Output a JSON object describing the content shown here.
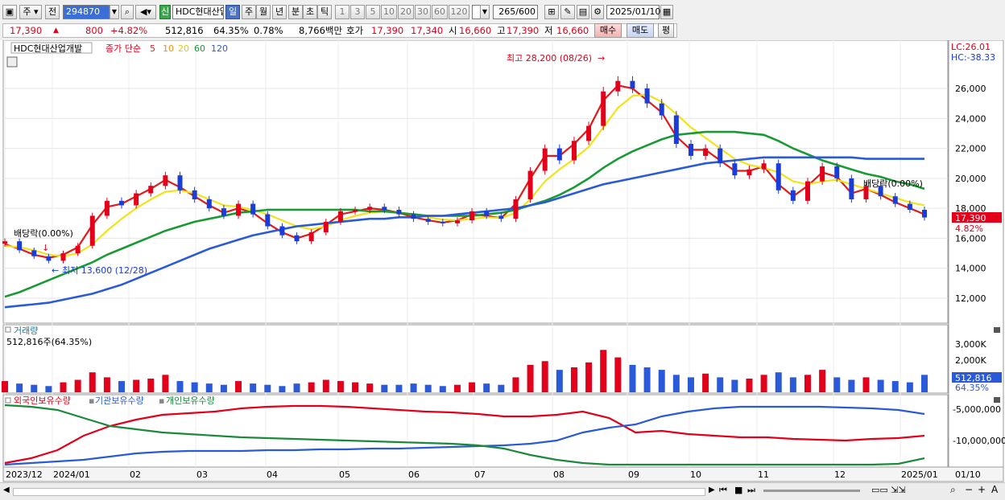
{
  "toolbar": {
    "period_label": "주",
    "prev_label": "전",
    "code_value": "294870",
    "new_badge": "신",
    "stock_name": "HDC현대산업",
    "period_buttons": [
      "일",
      "주",
      "월",
      "년",
      "분",
      "초",
      "틱"
    ],
    "interval_buttons": [
      "1",
      "3",
      "5",
      "10",
      "20",
      "30",
      "60",
      "120"
    ],
    "count_value": "265",
    "count_total": "/600",
    "date_value": "2025/01/10"
  },
  "quote": {
    "price": "17,390",
    "change": "800",
    "change_pct": "+4.82%",
    "volume": "512,816",
    "volume_ratio": "64.35%",
    "turnover": "0.78%",
    "amount": "8,766백만",
    "bid_label": "호가",
    "ask": "17,390",
    "bid": "17,340",
    "open_label": "시",
    "open": "16,660",
    "high_label": "고",
    "high": "17,390",
    "low_label": "저",
    "low": "16,660",
    "buy_button": "매수",
    "sell_button": "매도",
    "eval_button": "평"
  },
  "price_panel": {
    "legend_name": "HDC현대산업개발",
    "legend_ma_title": "종가 단순",
    "ma_periods": [
      "5",
      "10",
      "20",
      "60",
      "120"
    ],
    "ma_colors": [
      "#e21a1a",
      "#f08a1a",
      "#f2e21a",
      "#1a9a34",
      "#2a5ad8"
    ],
    "lc_label": "LC:26.01",
    "hc_label": "HC:-38.33",
    "y_ticks": [
      "26,000",
      "24,000",
      "22,000",
      "20,000",
      "18,000",
      "16,000",
      "14,000",
      "12,000"
    ],
    "current_price_tag": "17,390",
    "current_change_tag": "4.82%",
    "annotation_high": "최고 28,200 (08/26)",
    "annotation_low": "최저 13,600 (12/28)",
    "annotation_div1": "배당락(0.00%)",
    "annotation_div2": "배당락(0.00%)"
  },
  "volume_panel": {
    "title": "거래량",
    "value_text": "512,816주(64.35%)",
    "y_ticks": [
      "3,000K",
      "2,000K",
      "1,000K"
    ],
    "current_tag": "512,816",
    "current_pct": "64.35%"
  },
  "holding_panel": {
    "legend": [
      "외국인보유수량",
      "기관보유수량",
      "개인보유수량"
    ],
    "colors": [
      "#e2001a",
      "#2a5ad8",
      "#1a8a3a"
    ],
    "y_ticks": [
      "-5,000,000",
      "-10,000,000"
    ]
  },
  "x_axis": {
    "labels": [
      "2023/12",
      "2024/01",
      "02",
      "03",
      "04",
      "05",
      "06",
      "07",
      "08",
      "09",
      "10",
      "11",
      "12",
      "2025/01"
    ],
    "right_label": "01/10"
  },
  "chart_data": {
    "type": "candlestick",
    "title": "HDC현대산업개발",
    "ylim": [
      11000,
      28500
    ],
    "series": [
      {
        "name": "종가",
        "points": [
          15800,
          15200,
          14800,
          14500,
          15000,
          15500,
          17500,
          18500,
          18200,
          19000,
          19500,
          20200,
          19200,
          18600,
          18000,
          17500,
          18300,
          17600,
          16800,
          16200,
          15800,
          16400,
          17100,
          17800,
          17900,
          18100,
          17900,
          17600,
          17300,
          17100,
          17000,
          17200,
          17800,
          17500,
          17300,
          18600,
          20500,
          22000,
          21200,
          22500,
          23500,
          25800,
          26500,
          26000,
          25000,
          24200,
          22300,
          21500,
          22000,
          21000,
          20200,
          20600,
          21000,
          19200,
          18500,
          19800,
          20800,
          20000,
          18600,
          19500,
          18800,
          18300,
          17900,
          17390
        ]
      },
      {
        "name": "5",
        "points": [
          15600,
          15300,
          14900,
          14700,
          14900,
          15400,
          16900,
          18100,
          18300,
          18800,
          19300,
          19900,
          19400,
          18800,
          18200,
          17700,
          18000,
          17700,
          17000,
          16400,
          16000,
          16300,
          16900,
          17600,
          17800,
          18000,
          17900,
          17700,
          17400,
          17200,
          17050,
          17200,
          17600,
          17500,
          17350,
          18300,
          20000,
          21500,
          21500,
          22300,
          23300,
          25200,
          26200,
          26000,
          25200,
          24400,
          22800,
          21900,
          21900,
          21200,
          20500,
          20500,
          20800,
          19600,
          18800,
          19500,
          20400,
          20100,
          19000,
          19300,
          18900,
          18400,
          18000,
          17600
        ]
      },
      {
        "name": "20",
        "points": [
          15500,
          15400,
          15200,
          14900,
          14800,
          15000,
          15600,
          16500,
          17300,
          18000,
          18600,
          19100,
          19200,
          19000,
          18600,
          18200,
          18100,
          17900,
          17600,
          17200,
          16800,
          16600,
          16800,
          17200,
          17500,
          17700,
          17800,
          17700,
          17600,
          17400,
          17250,
          17200,
          17300,
          17400,
          17350,
          17700,
          18600,
          19800,
          20600,
          21300,
          22100,
          23400,
          24700,
          25500,
          25600,
          25100,
          24300,
          23400,
          22700,
          22000,
          21300,
          20900,
          20700,
          20400,
          19800,
          19600,
          19800,
          19900,
          19600,
          19300,
          19000,
          18700,
          18400,
          18200
        ]
      },
      {
        "name": "60",
        "points": [
          12100,
          12400,
          12800,
          13200,
          13600,
          14000,
          14400,
          14900,
          15300,
          15700,
          16100,
          16500,
          16800,
          17100,
          17300,
          17500,
          17700,
          17800,
          17900,
          17900,
          17900,
          17900,
          17900,
          17900,
          17900,
          17800,
          17800,
          17700,
          17600,
          17500,
          17500,
          17500,
          17500,
          17600,
          17700,
          17900,
          18200,
          18500,
          18900,
          19400,
          20000,
          20700,
          21300,
          21800,
          22200,
          22600,
          22900,
          23000,
          23100,
          23100,
          23100,
          23000,
          22900,
          22500,
          22000,
          21600,
          21200,
          20900,
          20600,
          20300,
          20100,
          19800,
          19600,
          19300
        ]
      },
      {
        "name": "120",
        "points": [
          11400,
          11500,
          11600,
          11700,
          11900,
          12100,
          12300,
          12600,
          12900,
          13300,
          13700,
          14100,
          14500,
          14900,
          15300,
          15600,
          15900,
          16200,
          16400,
          16600,
          16800,
          16900,
          17000,
          17100,
          17200,
          17300,
          17300,
          17400,
          17400,
          17500,
          17500,
          17600,
          17700,
          17800,
          17900,
          18000,
          18200,
          18400,
          18700,
          19000,
          19300,
          19600,
          19800,
          20000,
          20200,
          20400,
          20600,
          20800,
          21000,
          21100,
          21200,
          21300,
          21400,
          21400,
          21400,
          21400,
          21400,
          21400,
          21400,
          21300,
          21300,
          21300,
          21300,
          21300
        ]
      }
    ],
    "volume": [
      9,
      7,
      6,
      5,
      8,
      10,
      16,
      12,
      9,
      10,
      11,
      14,
      9,
      8,
      7,
      6,
      9,
      7,
      6,
      5,
      7,
      8,
      10,
      9,
      8,
      7,
      6,
      6,
      7,
      6,
      5,
      6,
      8,
      7,
      6,
      12,
      22,
      25,
      18,
      20,
      24,
      34,
      28,
      22,
      20,
      18,
      14,
      12,
      15,
      12,
      10,
      11,
      14,
      16,
      12,
      14,
      18,
      12,
      10,
      12,
      10,
      9,
      8,
      14
    ]
  }
}
